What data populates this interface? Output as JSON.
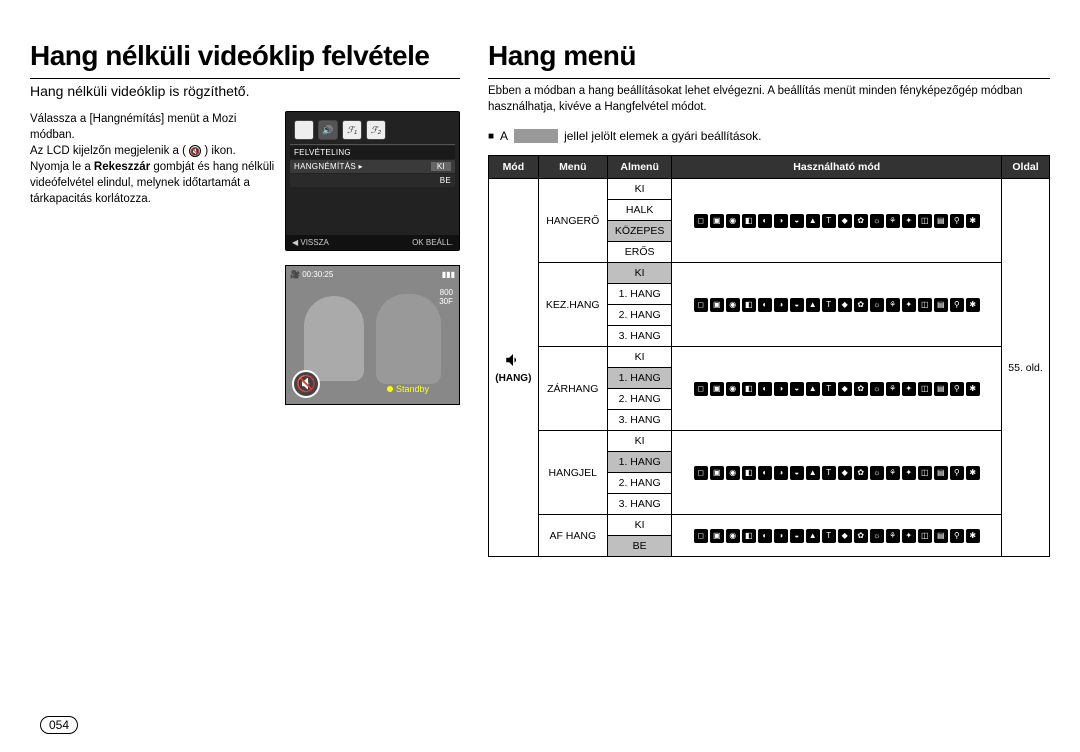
{
  "page_number": "054",
  "left": {
    "title": "Hang nélküli videóklip felvétele",
    "subtitle": "Hang nélküli videóklip is rögzíthető.",
    "para1": "Válassza a [Hangnémítás] menüt a Mozi módban.",
    "para2a": "Az LCD kijelzőn megjelenik a (",
    "para2b": ") ikon.",
    "para3a": "Nyomja le a ",
    "para3_bold": "Rekeszzár",
    "para3b": " gombját és hang nélküli videófelvétel elindul, melynek időtartamát a tárkapacitás korlátozza.",
    "lcd": {
      "menu_title": "FELVÉTELING",
      "row1_label": "HANGNÉMÍTÁS ▸",
      "row1_val": "KI",
      "row2_val": "BE",
      "back": "◀  VISSZA",
      "ok": "OK  BEÁLL."
    },
    "photo": {
      "time": "00:30:25",
      "res": "800",
      "fps": "30F",
      "standby": "Standby"
    }
  },
  "right": {
    "title": "Hang menü",
    "intro": "Ebben a módban a hang beállításokat lehet elvégezni. A beállítás menüt minden fényképezőgép módban használhatja, kivéve a Hangfelvétel módot.",
    "note_a": "A",
    "note_b": "jellel jelölt elemek a gyári beállítások.",
    "headers": {
      "mod": "Mód",
      "menu": "Menü",
      "almenu": "Almenü",
      "hasz": "Használható mód",
      "oldal": "Oldal"
    },
    "mode_label": "(HANG)",
    "page_ref": "55. old.",
    "menus": {
      "hangero": {
        "label": "HANGERŐ",
        "items": [
          "KI",
          "HALK",
          "KÖZEPES",
          "ERŐS"
        ],
        "default_index": 2
      },
      "kezhang": {
        "label": "KEZ.HANG",
        "items": [
          "KI",
          "1. HANG",
          "2. HANG",
          "3. HANG"
        ],
        "default_index": 0
      },
      "zarhang": {
        "label": "ZÁRHANG",
        "items": [
          "KI",
          "1. HANG",
          "2. HANG",
          "3. HANG"
        ],
        "default_index": 1
      },
      "hangjel": {
        "label": "HANGJEL",
        "items": [
          "KI",
          "1. HANG",
          "2. HANG",
          "3. HANG"
        ],
        "default_index": 1
      },
      "afhang": {
        "label": "AF HANG",
        "items": [
          "KI",
          "BE"
        ],
        "default_index": 1
      }
    }
  },
  "chart_data": {
    "type": "table",
    "title": "Hang menü beállítások",
    "columns": [
      "Mód",
      "Menü",
      "Almenü",
      "Használható mód",
      "Oldal"
    ],
    "rows": [
      {
        "mod": "HANG",
        "menu": "HANGERŐ",
        "almenu": "KI",
        "default": false
      },
      {
        "mod": "HANG",
        "menu": "HANGERŐ",
        "almenu": "HALK",
        "default": false
      },
      {
        "mod": "HANG",
        "menu": "HANGERŐ",
        "almenu": "KÖZEPES",
        "default": true
      },
      {
        "mod": "HANG",
        "menu": "HANGERŐ",
        "almenu": "ERŐS",
        "default": false
      },
      {
        "mod": "HANG",
        "menu": "KEZ.HANG",
        "almenu": "KI",
        "default": true
      },
      {
        "mod": "HANG",
        "menu": "KEZ.HANG",
        "almenu": "1. HANG",
        "default": false
      },
      {
        "mod": "HANG",
        "menu": "KEZ.HANG",
        "almenu": "2. HANG",
        "default": false
      },
      {
        "mod": "HANG",
        "menu": "KEZ.HANG",
        "almenu": "3. HANG",
        "default": false
      },
      {
        "mod": "HANG",
        "menu": "ZÁRHANG",
        "almenu": "KI",
        "default": false
      },
      {
        "mod": "HANG",
        "menu": "ZÁRHANG",
        "almenu": "1. HANG",
        "default": true
      },
      {
        "mod": "HANG",
        "menu": "ZÁRHANG",
        "almenu": "2. HANG",
        "default": false
      },
      {
        "mod": "HANG",
        "menu": "ZÁRHANG",
        "almenu": "3. HANG",
        "default": false
      },
      {
        "mod": "HANG",
        "menu": "HANGJEL",
        "almenu": "KI",
        "default": false
      },
      {
        "mod": "HANG",
        "menu": "HANGJEL",
        "almenu": "1. HANG",
        "default": true
      },
      {
        "mod": "HANG",
        "menu": "HANGJEL",
        "almenu": "2. HANG",
        "default": false
      },
      {
        "mod": "HANG",
        "menu": "HANGJEL",
        "almenu": "3. HANG",
        "default": false
      },
      {
        "mod": "HANG",
        "menu": "AF HANG",
        "almenu": "KI",
        "default": false
      },
      {
        "mod": "HANG",
        "menu": "AF HANG",
        "almenu": "BE",
        "default": true
      }
    ],
    "page_ref": "55. old."
  }
}
